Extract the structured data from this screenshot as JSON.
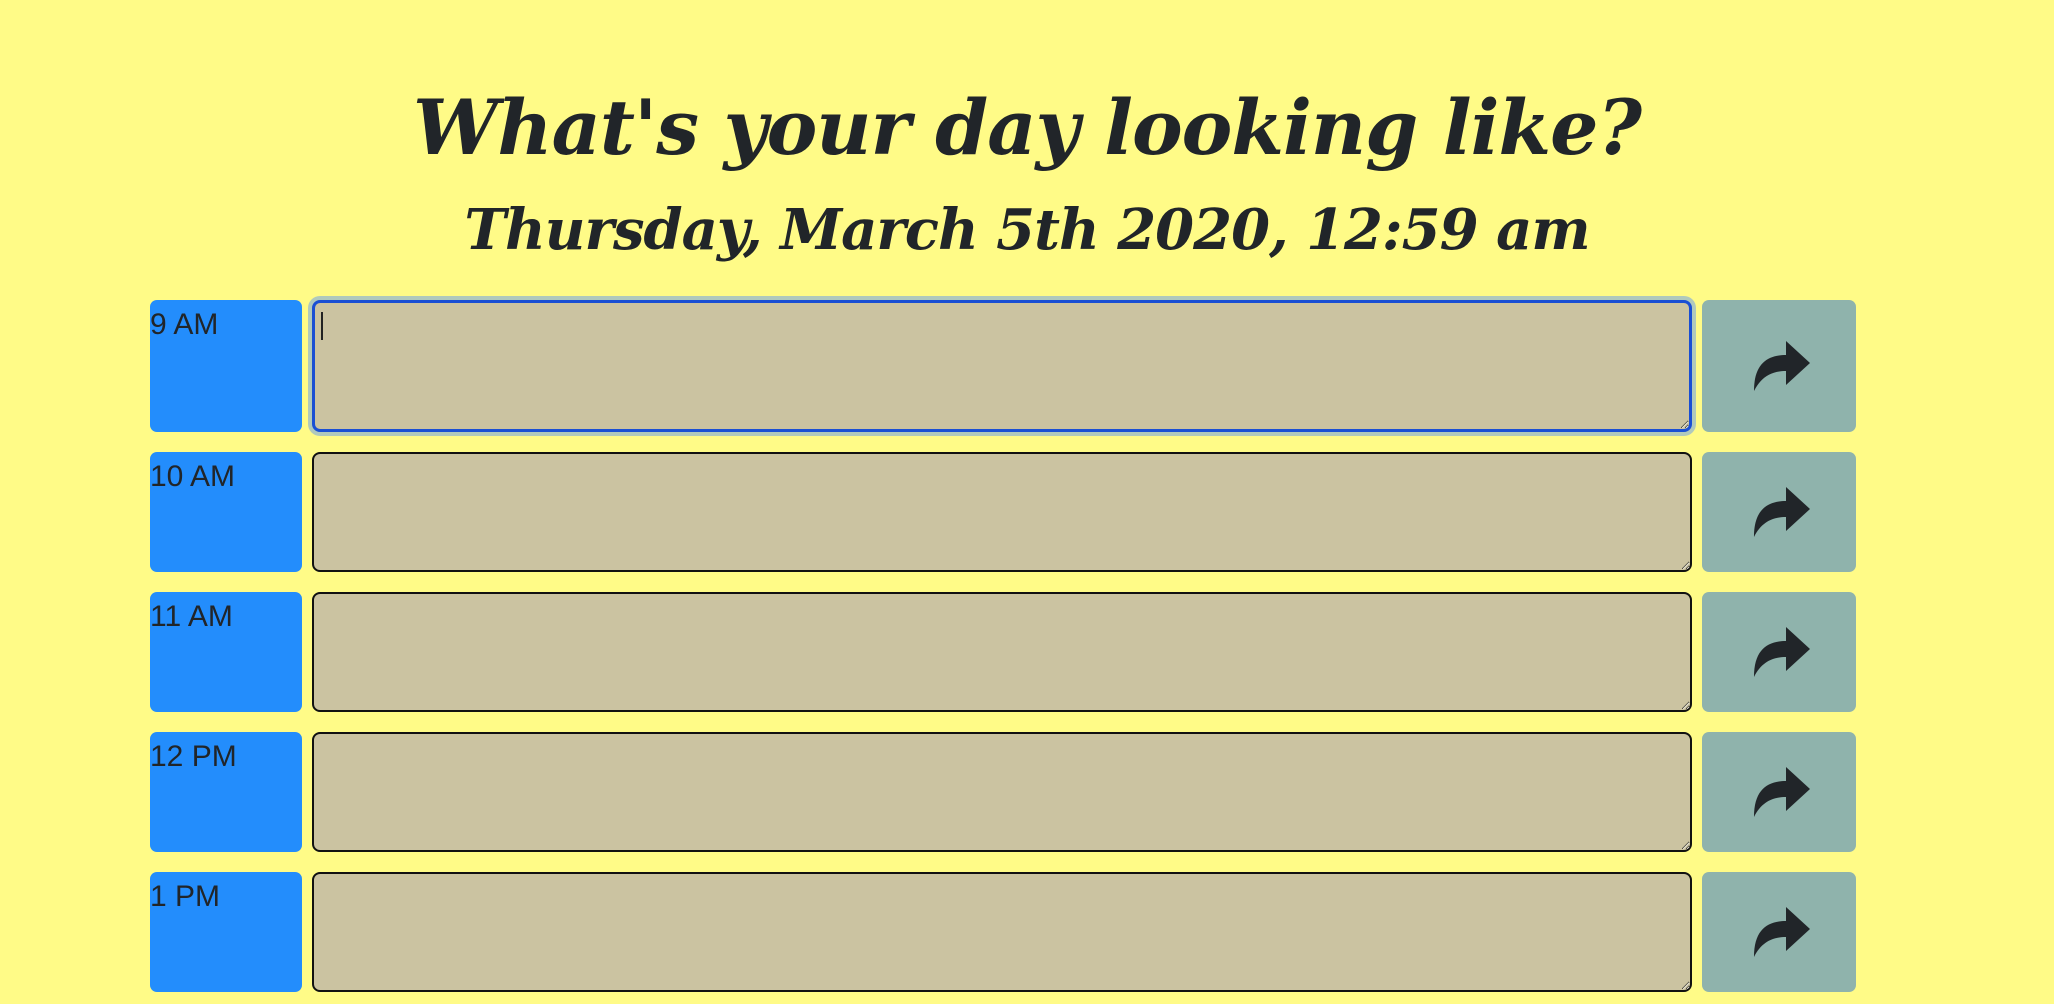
{
  "header": {
    "title": "What's your day looking like?",
    "current_datetime": "Thursday, March 5th 2020, 12:59 am"
  },
  "colors": {
    "background": "#fffb87",
    "hour_block": "#238dfc",
    "textarea": "#cbc3a1",
    "save_button": "#8fb3ac",
    "text": "#212529"
  },
  "schedule": {
    "rows": [
      {
        "hour": "9 AM",
        "task": "",
        "save_icon": "share-arrow-icon",
        "focused": true
      },
      {
        "hour": "10 AM",
        "task": "",
        "save_icon": "share-arrow-icon",
        "focused": false
      },
      {
        "hour": "11 AM",
        "task": "",
        "save_icon": "share-arrow-icon",
        "focused": false
      },
      {
        "hour": "12 PM",
        "task": "",
        "save_icon": "share-arrow-icon",
        "focused": false
      },
      {
        "hour": "1 PM",
        "task": "",
        "save_icon": "share-arrow-icon",
        "focused": false
      }
    ]
  }
}
